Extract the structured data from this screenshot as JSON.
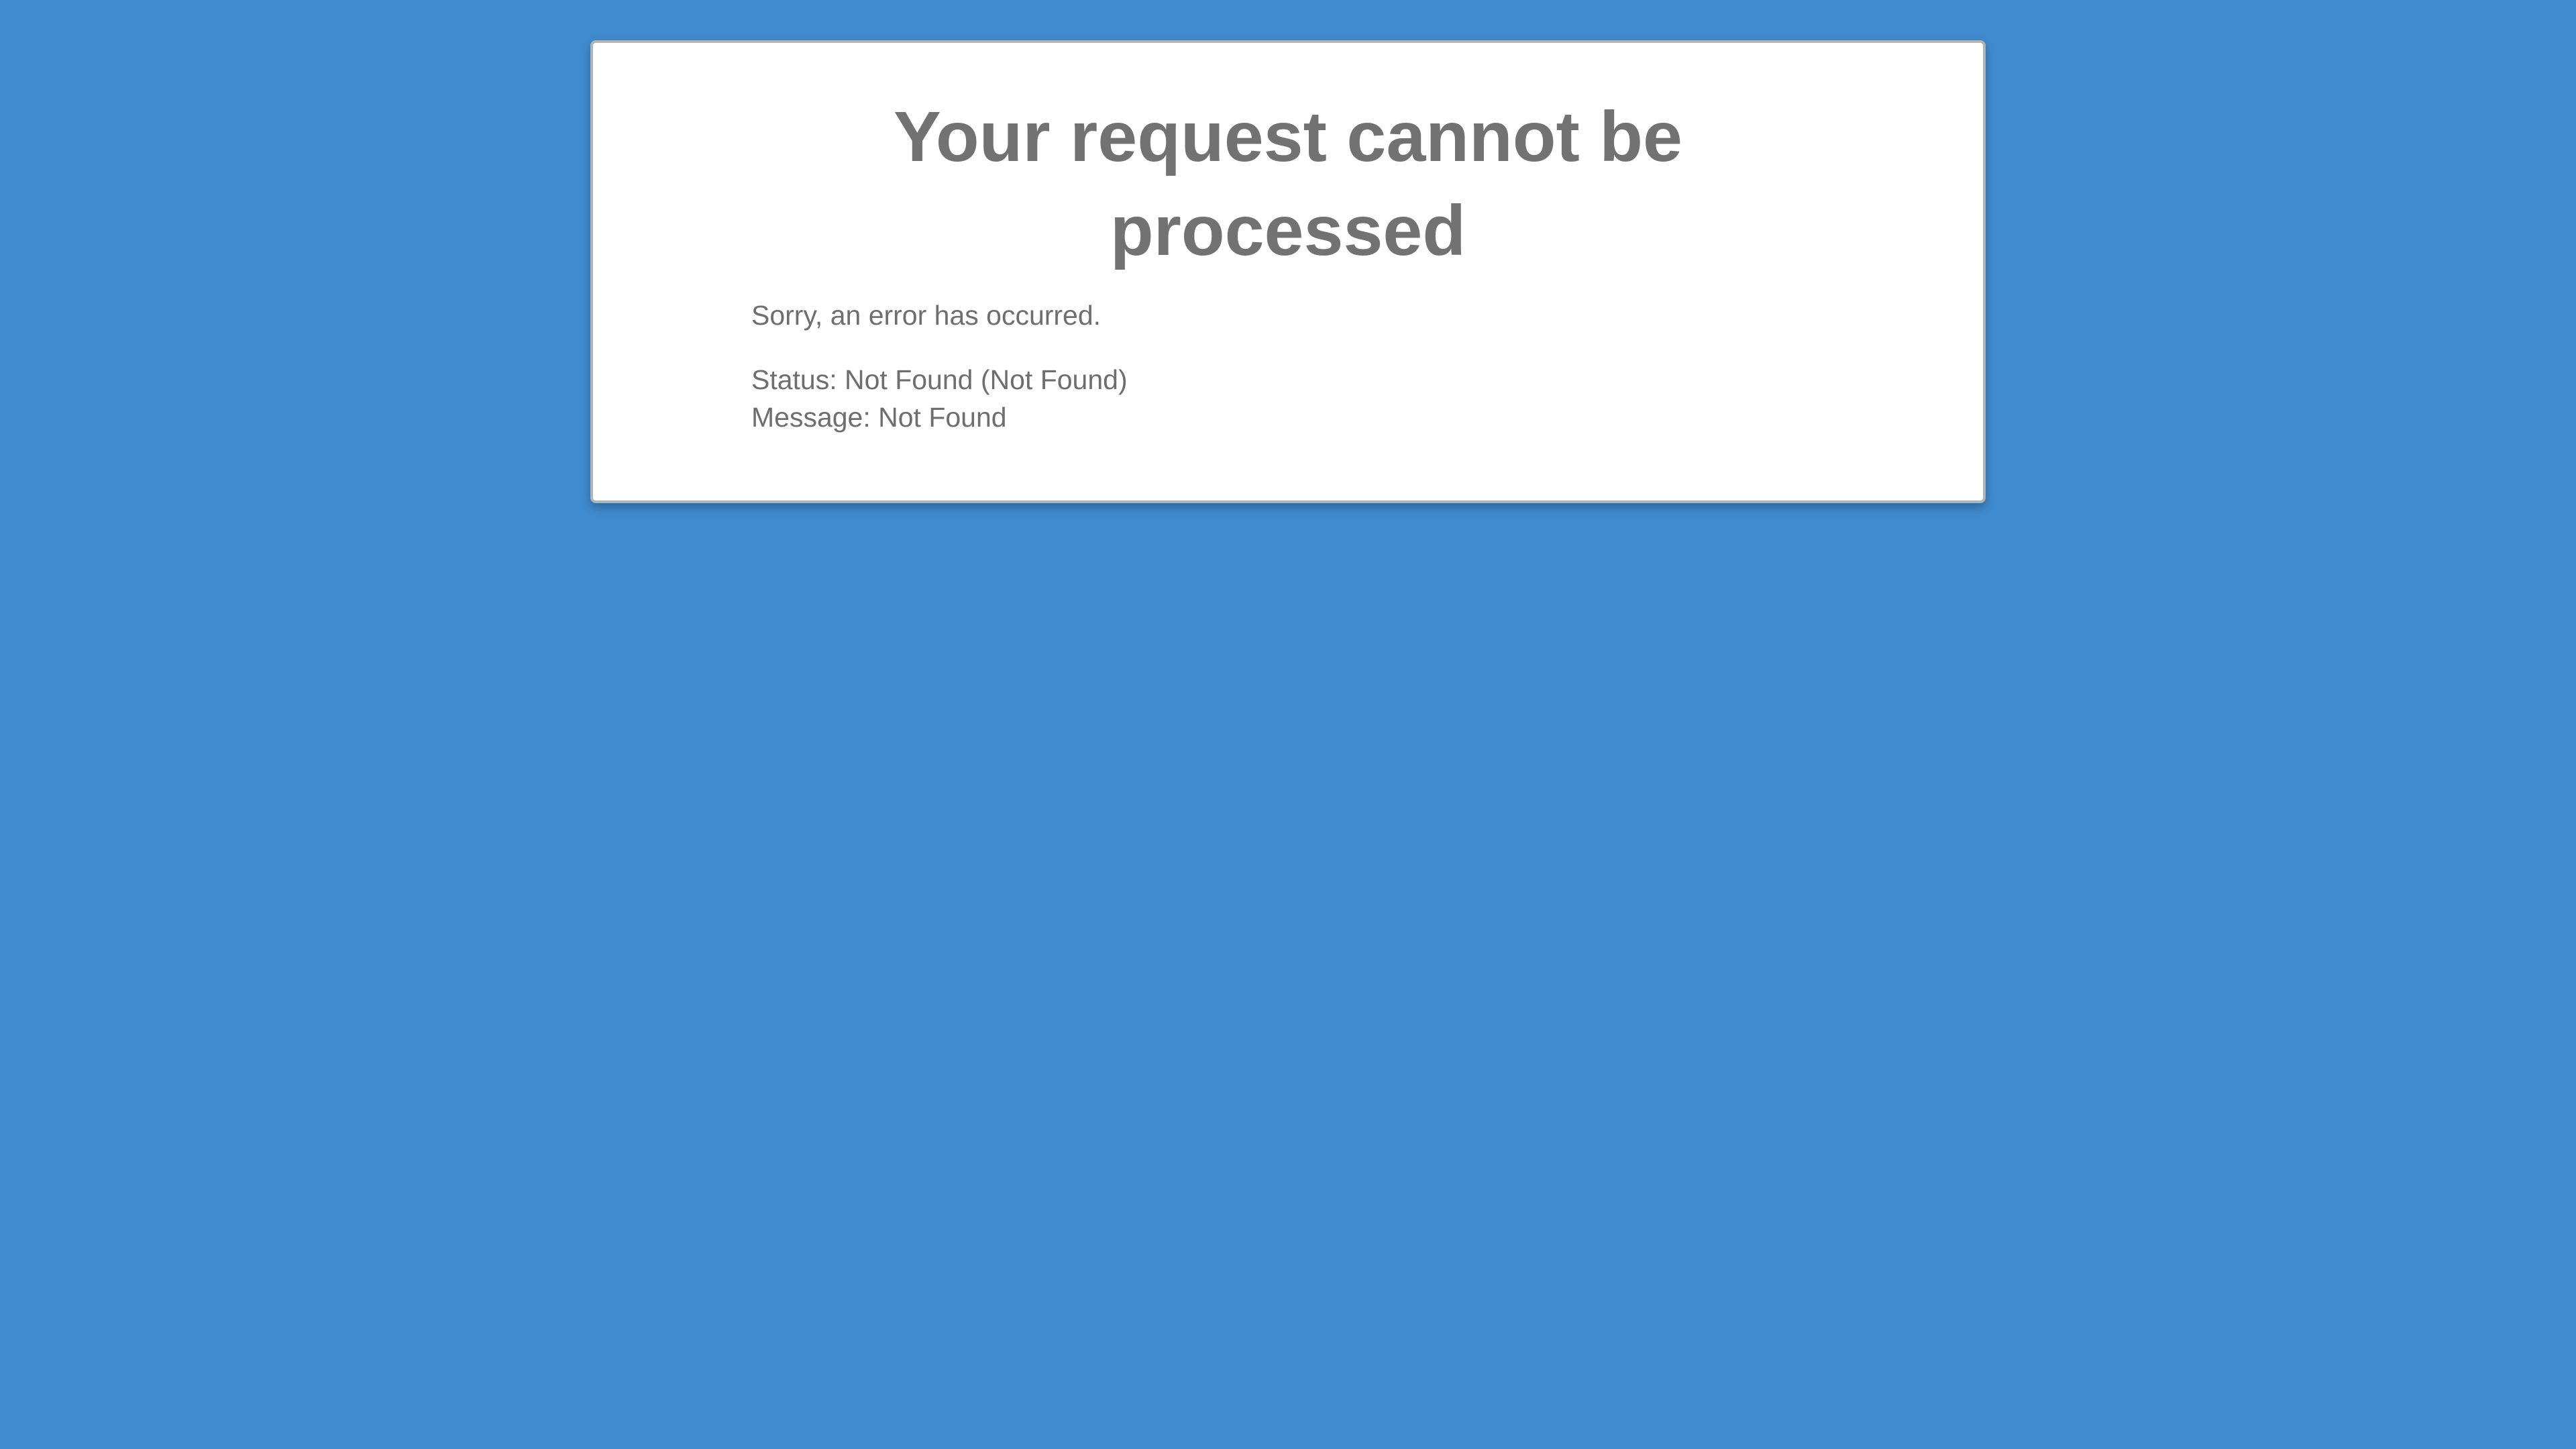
{
  "page": {
    "background_color": "#408bcf"
  },
  "error_card": {
    "background_color": "#ffffff",
    "border_color": "#b0b5ba",
    "text_color": "#727272",
    "title_line_1": "Your request cannot be",
    "title_line_2": "processed",
    "intro": "Sorry, an error has occurred.",
    "status": "Status: Not Found (Not Found)",
    "message": "Message: Not Found"
  }
}
